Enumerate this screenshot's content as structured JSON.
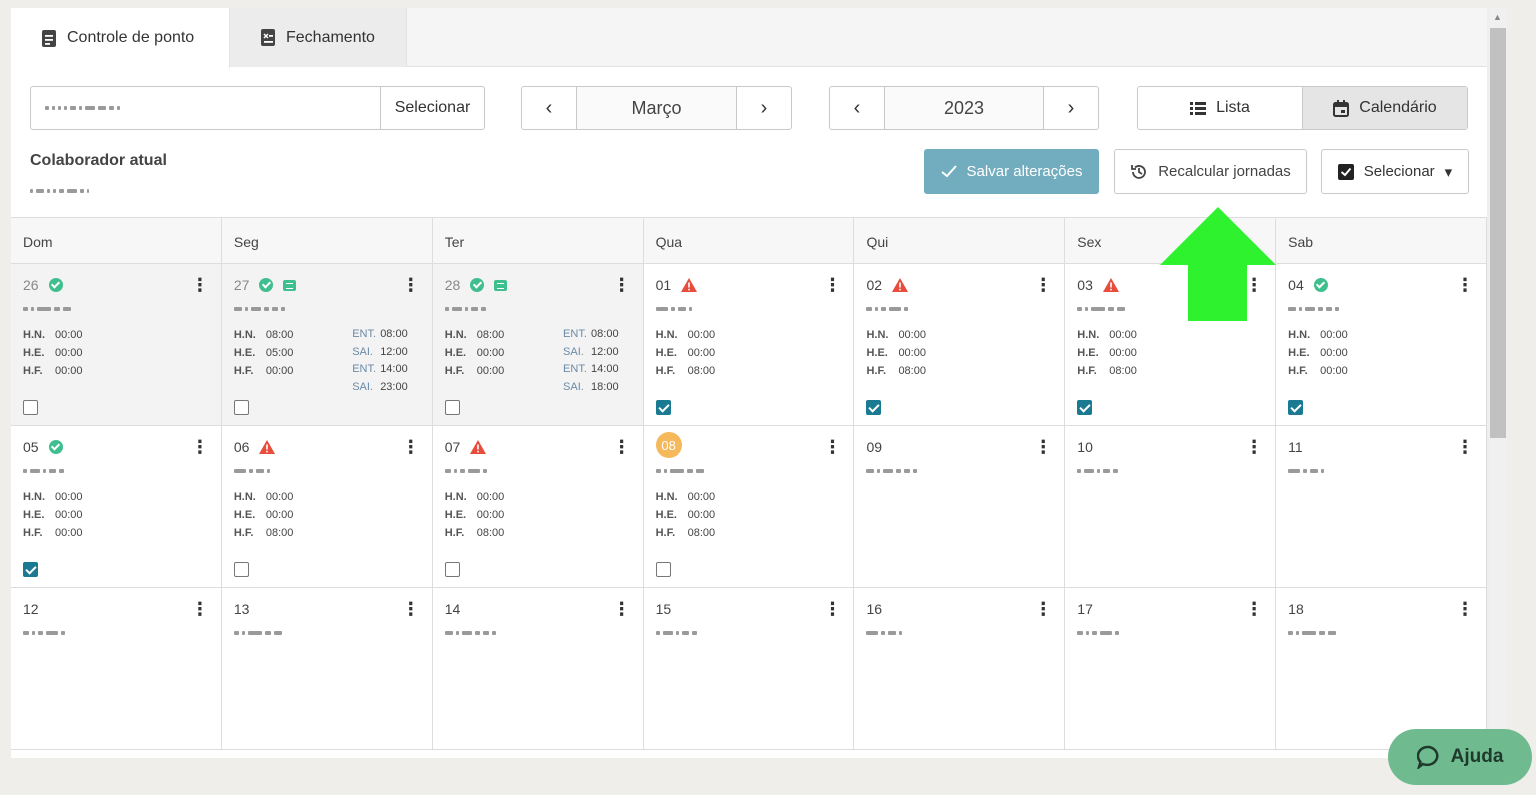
{
  "tabs": [
    {
      "label": "Controle de ponto"
    },
    {
      "label": "Fechamento"
    }
  ],
  "employee_selector": {
    "button_label": "Selecionar"
  },
  "month_nav": {
    "value": "Março",
    "prev": "‹",
    "next": "›"
  },
  "year_nav": {
    "value": "2023",
    "prev": "‹",
    "next": "›"
  },
  "view_toggle": {
    "list": "Lista",
    "calendar": "Calendário",
    "active": "Calendário"
  },
  "collaborator": {
    "title": "Colaborador atual"
  },
  "actions": {
    "save": "Salvar alterações",
    "recalc": "Recalcular jornadas",
    "select": "Selecionar"
  },
  "weekdays": [
    "Dom",
    "Seg",
    "Ter",
    "Qua",
    "Qui",
    "Sex",
    "Sab"
  ],
  "hour_labels": {
    "hn": "H.N.",
    "he": "H.E.",
    "hf": "H.F.",
    "ent": "ENT.",
    "sai": "SAI."
  },
  "weeks": [
    [
      {
        "day": "26",
        "muted": true,
        "status": "ok",
        "hn": "00:00",
        "he": "00:00",
        "hf": "00:00",
        "checked": false
      },
      {
        "day": "27",
        "muted": true,
        "status": "ok",
        "flag": true,
        "hn": "08:00",
        "he": "05:00",
        "hf": "00:00",
        "punches": [
          "08:00",
          "12:00",
          "14:00",
          "23:00"
        ],
        "checked": false
      },
      {
        "day": "28",
        "muted": true,
        "status": "ok",
        "flag": true,
        "hn": "08:00",
        "he": "00:00",
        "hf": "00:00",
        "punches": [
          "08:00",
          "12:00",
          "14:00",
          "18:00"
        ],
        "checked": false
      },
      {
        "day": "01",
        "status": "warn",
        "hn": "00:00",
        "he": "00:00",
        "hf": "08:00",
        "checked": true
      },
      {
        "day": "02",
        "status": "warn",
        "hn": "00:00",
        "he": "00:00",
        "hf": "08:00",
        "checked": true
      },
      {
        "day": "03",
        "status": "warn",
        "hn": "00:00",
        "he": "00:00",
        "hf": "08:00",
        "checked": true
      },
      {
        "day": "04",
        "status": "ok",
        "hn": "00:00",
        "he": "00:00",
        "hf": "00:00",
        "checked": true
      }
    ],
    [
      {
        "day": "05",
        "status": "ok",
        "hn": "00:00",
        "he": "00:00",
        "hf": "00:00",
        "checked": true
      },
      {
        "day": "06",
        "status": "warn",
        "hn": "00:00",
        "he": "00:00",
        "hf": "08:00",
        "checked": false
      },
      {
        "day": "07",
        "status": "warn",
        "hn": "00:00",
        "he": "00:00",
        "hf": "08:00",
        "checked": false
      },
      {
        "day": "08",
        "today": true,
        "hn": "00:00",
        "he": "00:00",
        "hf": "08:00",
        "checked": false
      },
      {
        "day": "09"
      },
      {
        "day": "10"
      },
      {
        "day": "11"
      }
    ],
    [
      {
        "day": "12"
      },
      {
        "day": "13"
      },
      {
        "day": "14"
      },
      {
        "day": "15"
      },
      {
        "day": "16"
      },
      {
        "day": "17"
      },
      {
        "day": "18"
      }
    ]
  ],
  "help": {
    "label": "Ajuda"
  },
  "colors": {
    "save": "#72adbf",
    "check": "#1a7a92",
    "ok": "#3fbf8f",
    "warn": "#e74c3c",
    "today": "#f5b85a",
    "help": "#6fbb8f",
    "pointer_arrow": "#2ef22e"
  },
  "icons": {
    "kebab": "⋮",
    "caret": "▾"
  }
}
